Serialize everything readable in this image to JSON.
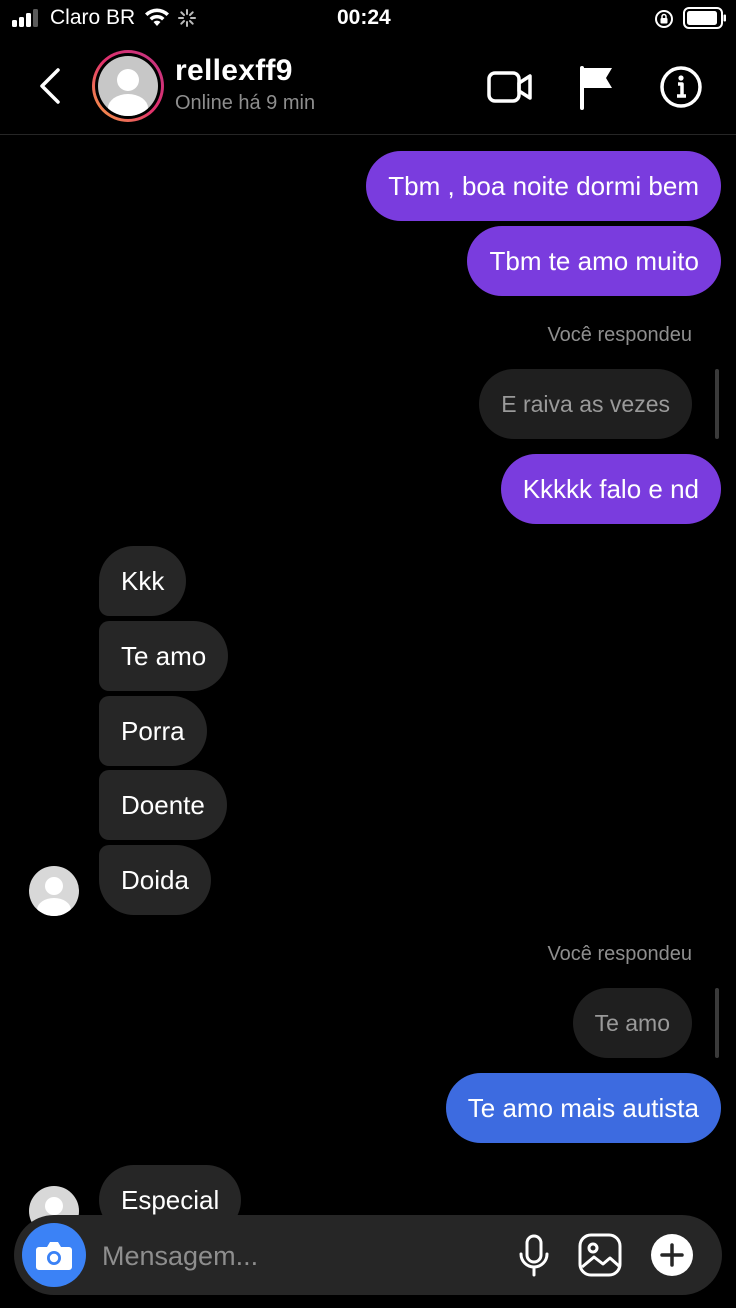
{
  "status_bar": {
    "carrier": "Claro BR",
    "time": "00:24"
  },
  "header": {
    "username": "rellexff9",
    "presence": "Online há 9 min"
  },
  "messages": [
    {
      "from": "me",
      "text": "Tbm , boa noite dormi bem"
    },
    {
      "from": "me",
      "text": "Tbm te amo muito"
    },
    {
      "label": "Você respondeu",
      "quoted": "E raiva as vezes"
    },
    {
      "from": "me",
      "text": "Kkkkk falo e nd"
    },
    {
      "from": "them",
      "text": "Kkk"
    },
    {
      "from": "them",
      "text": "Te amo"
    },
    {
      "from": "them",
      "text": "Porra"
    },
    {
      "from": "them",
      "text": "Doente"
    },
    {
      "from": "them",
      "text": "Doida"
    },
    {
      "label": "Você respondeu",
      "quoted": "Te amo"
    },
    {
      "from": "me",
      "text": "Te amo mais autista"
    },
    {
      "from": "them",
      "text": "Especial"
    }
  ],
  "composer": {
    "placeholder": "Mensagem..."
  },
  "colors": {
    "sent_purple": "#7a3cde",
    "sent_blue": "#3d6be0",
    "received": "#262626",
    "camera_button": "#3b82f6"
  },
  "icons": [
    "back-chevron-icon",
    "video-call-icon",
    "flag-icon",
    "info-icon",
    "camera-icon",
    "microphone-icon",
    "gallery-icon",
    "plus-icon"
  ]
}
